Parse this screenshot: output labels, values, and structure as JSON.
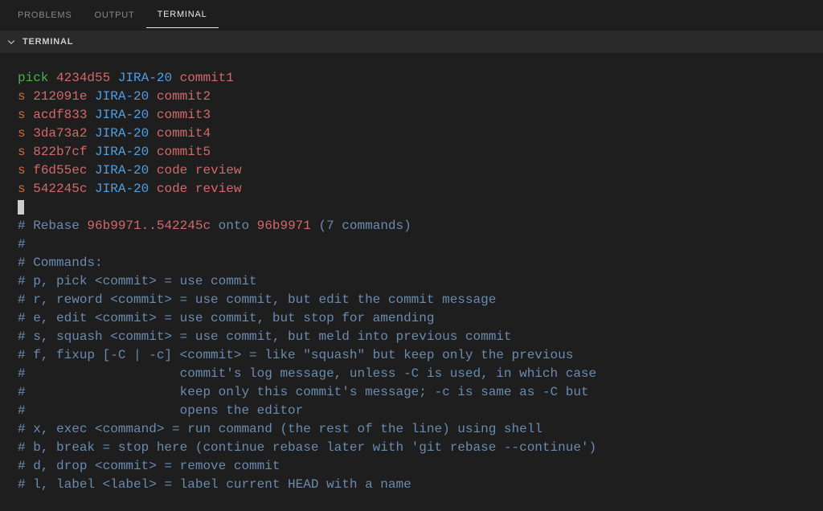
{
  "tabs": {
    "problems": "PROBLEMS",
    "output": "OUTPUT",
    "terminal": "TERMINAL"
  },
  "panel": {
    "title": "TERMINAL"
  },
  "rebase": {
    "lines": [
      {
        "action": "pick",
        "hash": "4234d55",
        "ticket": "JIRA-20",
        "msg": "commit1"
      },
      {
        "action": "s",
        "hash": "212091e",
        "ticket": "JIRA-20",
        "msg": "commit2"
      },
      {
        "action": "s",
        "hash": "acdf833",
        "ticket": "JIRA-20",
        "msg": "commit3"
      },
      {
        "action": "s",
        "hash": "3da73a2",
        "ticket": "JIRA-20",
        "msg": "commit4"
      },
      {
        "action": "s",
        "hash": "822b7cf",
        "ticket": "JIRA-20",
        "msg": "commit5"
      },
      {
        "action": "s",
        "hash": "f6d55ec",
        "ticket": "JIRA-20",
        "msg": "code review"
      },
      {
        "action": "s",
        "hash": "542245c",
        "ticket": "JIRA-20",
        "msg": "code review"
      }
    ],
    "header": {
      "hash": "#",
      "word_rebase": "Rebase",
      "range": "96b9971..542245c",
      "onto": "onto",
      "target": "96b9971",
      "count": "(7 commands)"
    },
    "comments": [
      "#",
      "# Commands:",
      "# p, pick <commit> = use commit",
      "# r, reword <commit> = use commit, but edit the commit message",
      "# e, edit <commit> = use commit, but stop for amending",
      "# s, squash <commit> = use commit, but meld into previous commit",
      "# f, fixup [-C | -c] <commit> = like \"squash\" but keep only the previous",
      "#                    commit's log message, unless -C is used, in which case",
      "#                    keep only this commit's message; -c is same as -C but",
      "#                    opens the editor",
      "# x, exec <command> = run command (the rest of the line) using shell",
      "# b, break = stop here (continue rebase later with 'git rebase --continue')",
      "# d, drop <commit> = remove commit",
      "# l, label <label> = label current HEAD with a name"
    ]
  }
}
